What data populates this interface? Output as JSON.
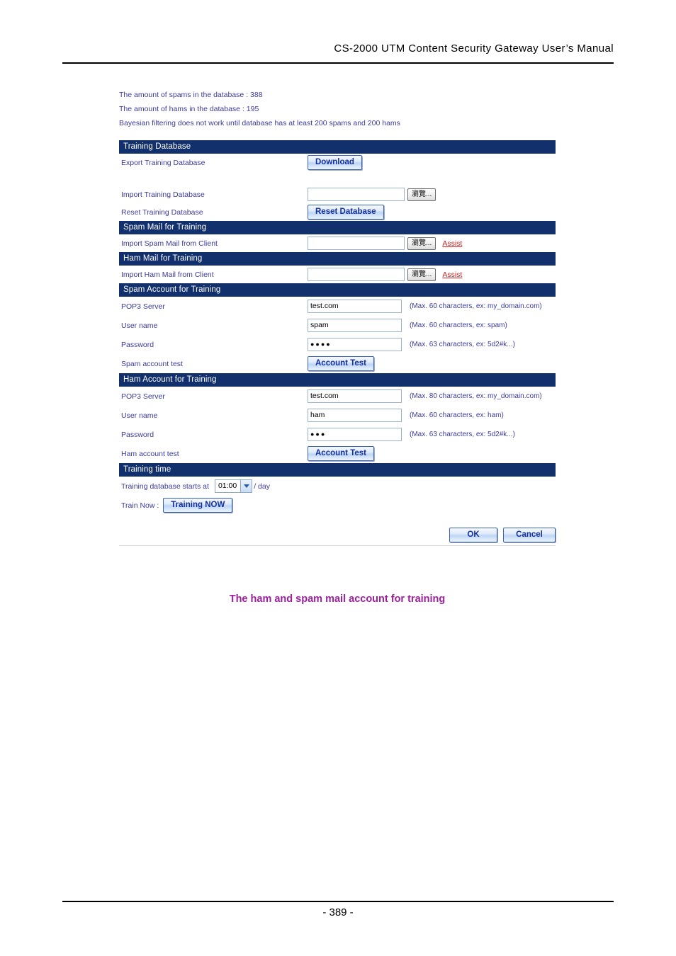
{
  "document": {
    "header_title": "CS-2000 UTM Content Security Gateway User’s Manual",
    "page_number": "- 389 -",
    "figure_caption": "The ham and spam mail account for training"
  },
  "colors": {
    "section_header_bg": "#12306c",
    "label_text": "#3b3b9e",
    "link_assist": "#cc2222",
    "caption": "#9c1f9c",
    "button_text": "#1430a0"
  },
  "status": {
    "lines": [
      "The amount of spams in the database : 388",
      "The amount of hams in the database : 195",
      "Bayesian filtering does not work until database has at least 200 spams and 200 hams"
    ],
    "spam_count": "388",
    "ham_count": "195"
  },
  "sections": {
    "training_database": {
      "title": "Training Database",
      "export_label": "Export Training Database",
      "download_button": "Download",
      "import_label": "Import Training Database",
      "import_value": "",
      "import_placeholder": "",
      "browse_button": "瀏覽...",
      "reset_label": "Reset Training Database",
      "reset_button": "Reset Database"
    },
    "spam_mail": {
      "title": "Spam Mail for Training",
      "import_label": "Import Spam Mail from Client",
      "import_value": "",
      "browse_button": "瀏覽...",
      "assist_link": "Assist"
    },
    "ham_mail": {
      "title": "Ham Mail for Training",
      "import_label": "Import Ham Mail from Client",
      "import_value": "",
      "browse_button": "瀏覽...",
      "assist_link": "Assist"
    },
    "spam_account": {
      "title": "Spam Account for Training",
      "pop3_label": "POP3 Server",
      "pop3_value": "test.com",
      "pop3_hint": "(Max. 60 characters, ex: my_domain.com)",
      "user_label": "User name",
      "user_value": "spam",
      "user_hint": "(Max. 60 characters, ex: spam)",
      "password_label": "Password",
      "password_value": "●●●●",
      "password_hint": "(Max. 63 characters, ex: 5d2#k...)",
      "test_label": "Spam account test",
      "test_button": "Account Test"
    },
    "ham_account": {
      "title": "Ham Account for Training",
      "pop3_label": "POP3 Server",
      "pop3_value": "test.com",
      "pop3_hint": "(Max. 80 characters, ex: my_domain.com)",
      "user_label": "User name",
      "user_value": "ham",
      "user_hint": "(Max. 60 characters, ex: ham)",
      "password_label": "Password",
      "password_value": "●●●",
      "password_hint": "(Max. 63 characters, ex: 5d2#k...)",
      "test_label": "Ham account test",
      "test_button": "Account Test"
    },
    "training_time": {
      "title": "Training time",
      "starts_at_label": "Training database starts at",
      "time_value": "01:00",
      "per_day_label": "/ day",
      "train_now_label": "Train Now :",
      "train_now_button": "Training NOW"
    }
  },
  "footer": {
    "ok_button": "OK",
    "cancel_button": "Cancel"
  }
}
